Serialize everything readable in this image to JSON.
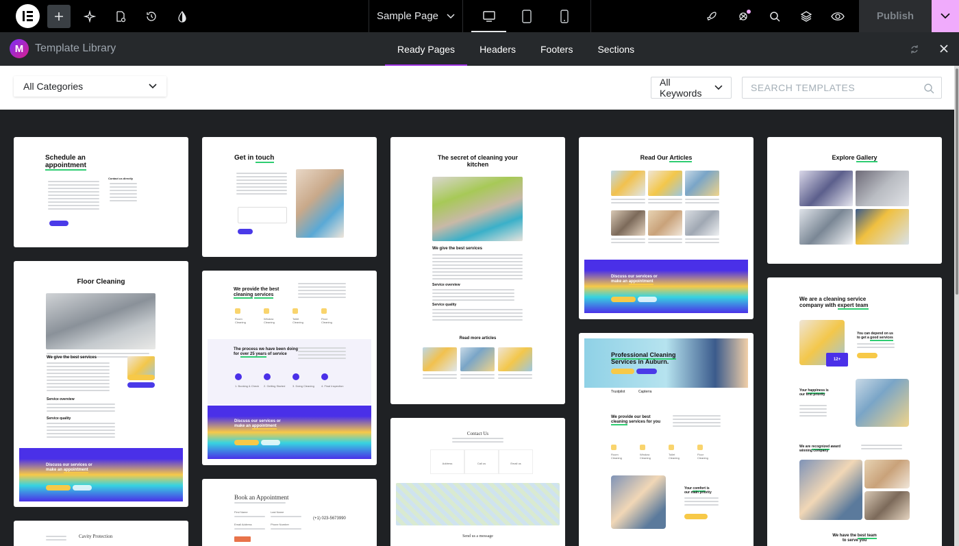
{
  "topbar": {
    "page_title": "Sample Page",
    "publish_label": "Publish"
  },
  "library": {
    "title": "Template Library",
    "tabs": [
      "Ready Pages",
      "Headers",
      "Footers",
      "Sections"
    ],
    "active_tab": "Ready Pages"
  },
  "filters": {
    "category": "All Categories",
    "keywords": "All Keywords",
    "search_placeholder": "SEARCH TEMPLATES"
  },
  "templates": {
    "schedule": {
      "title_a": "Schedule an",
      "title_b": "appointment",
      "side": "Contact us directly"
    },
    "touch": {
      "title_a": "Get in",
      "title_b": "touch"
    },
    "kitchen": {
      "title_a": "The secret of cleaning your",
      "title_b": "kitchen",
      "sub_a": "We give the best services",
      "more": "Read more articles",
      "sub_b": "Service overview",
      "sub_c": "Service quality"
    },
    "articles": {
      "title_a": "Read Our",
      "title_b": "Articles",
      "cta_a": "Discuss our services or",
      "cta_b": "make an",
      "cta_c": "appointment"
    },
    "gallery": {
      "title_a": "Explore",
      "title_b": "Gallery"
    },
    "floor": {
      "title": "Floor Cleaning",
      "sub_a": "We give the best services",
      "sub_b": "Service overview",
      "sub_c": "Service quality",
      "cta_a": "Discuss our services or",
      "cta_b": "make an",
      "cta_c": "appointment"
    },
    "provide": {
      "title_a": "We provide the best",
      "title_b": "cleaning",
      "title_c": "services",
      "process_a": "The process we have been doing",
      "process_b": "for",
      "process_c": "over 25 years",
      "process_d": "of service",
      "cta_a": "Discuss our services or",
      "cta_b": "make an",
      "cta_c": "appointment",
      "icons": [
        "Room Cleaning",
        "Window Cleaning",
        "Toilet Cleaning",
        "Floor Cleaning"
      ],
      "steps": [
        "1. Booking & Check",
        "2. Getting Started",
        "3. Doing Cleaning",
        "4. Final Inspection"
      ]
    },
    "company": {
      "title_a": "We are a cleaning service",
      "title_b": "company with",
      "title_c": "expert team",
      "block_a": "You can depend on us",
      "block_a2": "to get a",
      "block_a3": "good services",
      "block_b": "Your",
      "block_b2": "happiness",
      "block_b3": "is",
      "block_b4": "our first priority",
      "block_c": "We are",
      "block_c2": "recognized",
      "block_c3": "award",
      "block_c4": "winning company",
      "block_d": "We have the",
      "block_d2": "best team",
      "block_d3": "to serve you",
      "badge": "12+"
    },
    "contact": {
      "title": "Contact Us",
      "labels": [
        "Address",
        "Call us",
        "Email us"
      ],
      "send": "Send us a message"
    },
    "professional": {
      "title_a": "Professional Cleaning",
      "title_b": "Services in Auburn.",
      "review_a": "Trustpilot",
      "review_b": "Capterra",
      "provide_a": "We provide our best",
      "provide_b": "cleaning",
      "provide_c": "services for you",
      "comfort_a": "Your",
      "comfort_b": "comfort",
      "comfort_c": "is",
      "comfort_d": "our main priority",
      "icons": [
        "Room Cleaning",
        "Window Cleaning",
        "Toilet Cleaning",
        "Floor Cleaning"
      ]
    },
    "book": {
      "title": "Book an Appointment",
      "phone": "(+1) 023-5673990",
      "fields": [
        "First Name",
        "Last Name",
        "Email Address",
        "Phone Number"
      ]
    },
    "cavity": {
      "title": "Cavity Protection"
    }
  },
  "icons": {
    "logo": "elementor-logo-icon",
    "add": "plus-icon",
    "ai": "sparkle-icon",
    "page_settings": "page-settings-icon",
    "history": "history-icon",
    "site_settings": "droplet-icon",
    "desktop": "desktop-icon",
    "tablet": "tablet-icon",
    "mobile": "mobile-icon",
    "launch": "rocket-icon",
    "notes": "notification-icon",
    "finder": "search-icon",
    "structure": "layers-icon",
    "preview": "eye-icon",
    "more": "chevron-down-icon"
  },
  "colors": {
    "accent": "#4a30e8",
    "highlight": "#2ecc71",
    "button": "#f7c948",
    "publish_more": "#f0abfc"
  }
}
